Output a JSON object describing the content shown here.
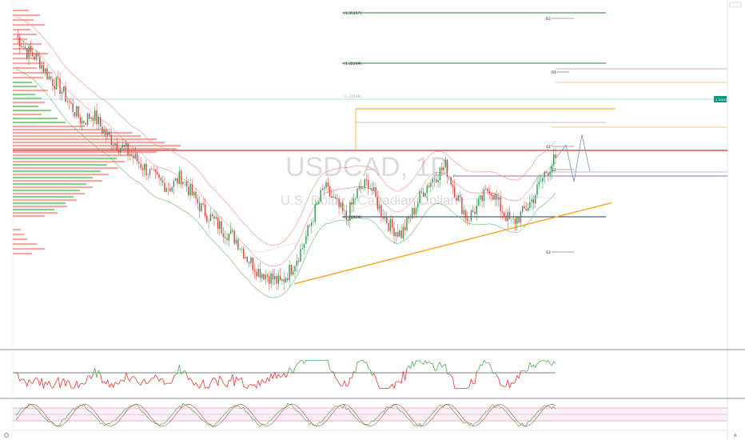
{
  "chart_data": {
    "type": "line",
    "title": "",
    "watermark": {
      "symbol": "USDCAD, 1D",
      "name": "U.S. Dollar / Canadian Dollar"
    },
    "price_badge": {
      "value": "1.35431",
      "color": "#089981"
    },
    "levels": [
      {
        "label": "(1.35157)",
        "color": "#2e7d32",
        "tag": "R2"
      },
      {
        "label": "(1.32249)",
        "color": "#2e7d32",
        "tag": "R1"
      },
      {
        "label": "(1.31518)",
        "color": "#8fc5cf",
        "tag": ""
      },
      {
        "label": "(1.28929)",
        "color": "#1a3b5c",
        "tag": "S2"
      },
      {
        "label": "",
        "color": "#1a3b5c",
        "tag": "S3"
      },
      {
        "label": "",
        "color": "#c2185b",
        "tag": "P"
      },
      {
        "label": "",
        "color": "#888888",
        "tag": "S1"
      }
    ],
    "price_path": [
      1.368,
      1.362,
      1.359,
      1.352,
      1.348,
      1.341,
      1.335,
      1.338,
      1.331,
      1.327,
      1.324,
      1.32,
      1.316,
      1.312,
      1.31,
      1.314,
      1.307,
      1.301,
      1.297,
      1.293,
      1.29,
      1.283,
      1.278,
      1.276,
      1.273,
      1.279,
      1.287,
      1.299,
      1.31,
      1.304,
      1.298,
      1.308,
      1.312,
      1.302,
      1.295,
      1.292,
      1.3,
      1.309,
      1.314,
      1.318,
      1.307,
      1.298,
      1.303,
      1.31,
      1.302,
      1.296,
      1.3,
      1.306,
      1.315,
      1.321
    ],
    "projection_path": [
      1.321,
      1.326,
      1.312,
      1.33,
      1.316
    ],
    "support_trendline": [
      1.273,
      1.304
    ],
    "ylim": [
      1.25,
      1.38
    ],
    "rsi": {
      "range": [
        0,
        100
      ],
      "midline": 50
    },
    "stoch": {
      "range": [
        0,
        100
      ],
      "bands": [
        20,
        80
      ]
    },
    "ylabels_visible": false
  }
}
